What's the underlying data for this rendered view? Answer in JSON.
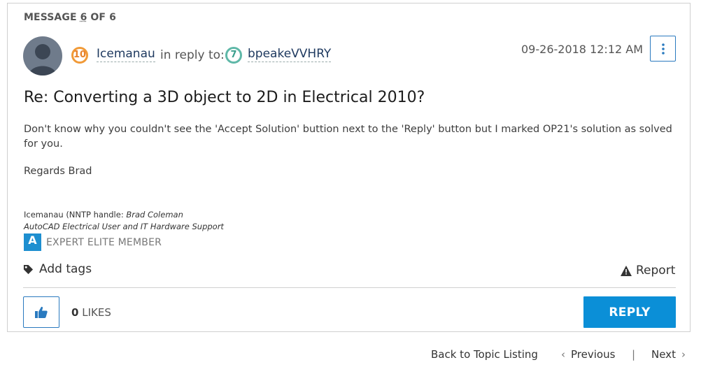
{
  "header": {
    "message_prefix": "MESSAGE ",
    "message_index": "6",
    "message_suffix": " OF 6"
  },
  "post": {
    "author": "Icemanau",
    "author_rank": "10",
    "in_reply_label": "in reply to:",
    "reply_to_user": "bpeakeVVHRY",
    "reply_to_rank": "7",
    "timestamp": "09-26-2018 12:12 AM",
    "subject": "Re: Converting a 3D object to 2D in Electrical 2010?",
    "body": "Don't know why you couldn't see the 'Accept Solution' buttion next to the 'Reply' button but I marked OP21's solution as solved for you.",
    "regards": "Regards Brad"
  },
  "signature": {
    "line1_prefix": "Icemanau (NNTP handle: ",
    "line1_name": "Brad Coleman",
    "line2": "AutoCAD Electrical User and IT Hardware Support",
    "badge_letter": "A",
    "badge_label": "EXPERT ELITE MEMBER"
  },
  "actions": {
    "add_tags": "Add tags",
    "report": "Report",
    "likes_count": "0",
    "likes_label": "LIKES",
    "reply": "REPLY"
  },
  "navigation": {
    "back": "Back to Topic Listing",
    "previous": "Previous",
    "separator": "|",
    "next": "Next"
  },
  "colors": {
    "accent": "#0b8fd7",
    "border_blue": "#2a7abf",
    "rank10": "#f19a38",
    "rank7": "#5fb8a8"
  }
}
